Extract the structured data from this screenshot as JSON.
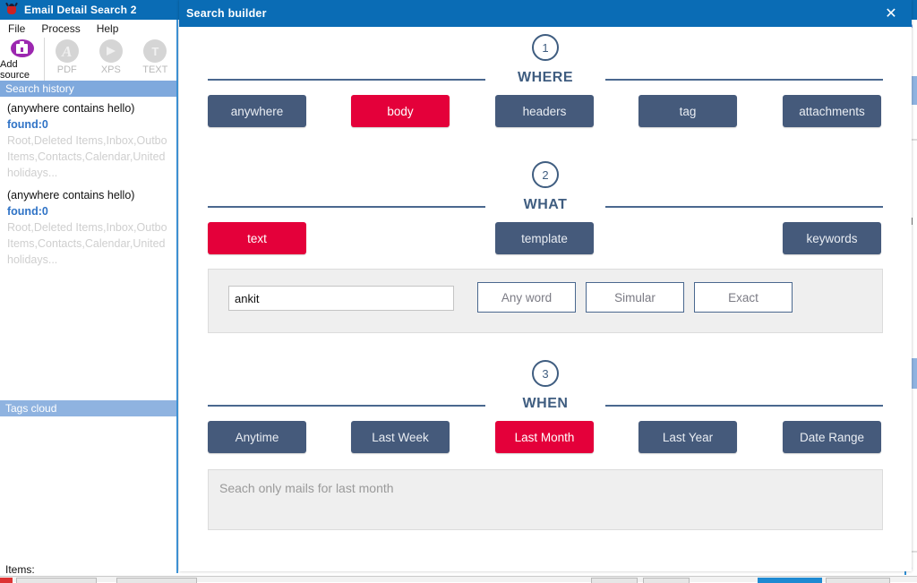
{
  "app": {
    "title": "Email Detail Search 2",
    "icon": "bug-icon",
    "menu": [
      "File",
      "Process",
      "Help"
    ],
    "toolbar": [
      {
        "label": "Add source",
        "icon": "add-source-icon",
        "enabled": true
      },
      {
        "label": "PDF",
        "icon": "pdf-icon",
        "enabled": false
      },
      {
        "label": "XPS",
        "icon": "xps-icon",
        "enabled": false
      },
      {
        "label": "TEXT",
        "icon": "text-icon",
        "enabled": false
      }
    ],
    "search_history": {
      "header": "Search history",
      "entries": [
        {
          "query": "(anywhere contains hello)",
          "found": "found:0",
          "path_line1": "Root,Deleted Items,Inbox,Outbo",
          "path_line2": "Items,Contacts,Calendar,United",
          "path_line3": "holidays..."
        },
        {
          "query": "(anywhere contains hello)",
          "found": "found:0",
          "path_line1": "Root,Deleted Items,Inbox,Outbo",
          "path_line2": "Items,Contacts,Calendar,United",
          "path_line3": "holidays..."
        }
      ]
    },
    "tags_cloud": {
      "header": "Tags cloud"
    },
    "status": {
      "items_label": "Items:"
    }
  },
  "dialog": {
    "title": "Search builder",
    "close_icon": "close-icon",
    "sections": [
      {
        "step": "1",
        "title": "WHERE",
        "options": [
          {
            "label": "anywhere",
            "selected": false
          },
          {
            "label": "body",
            "selected": true
          },
          {
            "label": "headers",
            "selected": false
          },
          {
            "label": "tag",
            "selected": false
          },
          {
            "label": "attachments",
            "selected": false
          }
        ]
      },
      {
        "step": "2",
        "title": "WHAT",
        "options": [
          {
            "label": "text",
            "selected": true
          },
          {
            "label": "template",
            "selected": false
          },
          {
            "label": "keywords",
            "selected": false
          }
        ],
        "text_panel": {
          "input_value": "ankit",
          "input_placeholder": "",
          "match_buttons": [
            {
              "label": "Any word",
              "selected": false
            },
            {
              "label": "Simular",
              "selected": false
            },
            {
              "label": "Exact",
              "selected": false
            }
          ]
        }
      },
      {
        "step": "3",
        "title": "WHEN",
        "options": [
          {
            "label": "Anytime",
            "selected": false
          },
          {
            "label": "Last Week",
            "selected": false
          },
          {
            "label": "Last Month",
            "selected": true
          },
          {
            "label": "Last Year",
            "selected": false
          },
          {
            "label": "Date Range",
            "selected": false
          }
        ],
        "note": "Seach only mails for last month"
      }
    ]
  },
  "colors": {
    "titlebar_blue": "#0a6cb5",
    "button_slate": "#455a7b",
    "selected_red": "#e4003a",
    "heading_navy": "#3f5d80",
    "panel_grey": "#efefef",
    "history_header": "#7fa9dd",
    "tags_header": "#8fb3e0",
    "found_link": "#2f73c6"
  }
}
